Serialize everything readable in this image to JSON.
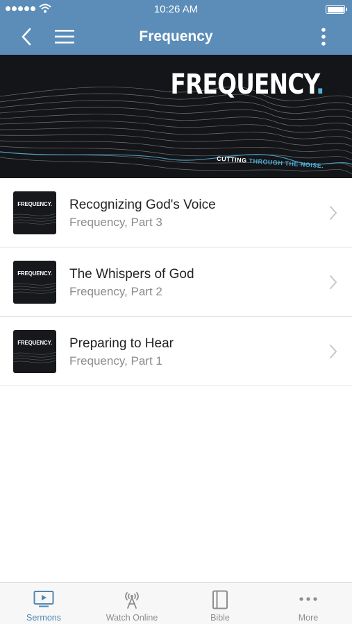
{
  "status_bar": {
    "time": "10:26 AM",
    "signal_icon": "signal-dots-icon",
    "wifi_icon": "wifi-icon",
    "battery_icon": "battery-icon"
  },
  "nav": {
    "title": "Frequency",
    "back_icon": "chevron-left-icon",
    "menu_icon": "hamburger-menu-icon",
    "more_icon": "vertical-dots-icon"
  },
  "banner": {
    "brand": "FREQUENCY",
    "brand_dot": ".",
    "tagline_a": "CUTTING",
    "tagline_b": "THROUGH THE NOISE."
  },
  "sermons": [
    {
      "title": "Recognizing God's Voice",
      "subtitle": "Frequency, Part 3",
      "thumb_label": "FREQUENCY."
    },
    {
      "title": "The Whispers of God",
      "subtitle": "Frequency, Part 2",
      "thumb_label": "FREQUENCY."
    },
    {
      "title": "Preparing to Hear",
      "subtitle": "Frequency, Part 1",
      "thumb_label": "FREQUENCY."
    }
  ],
  "tabs": [
    {
      "label": "Sermons",
      "icon": "tv-play-icon",
      "active": true
    },
    {
      "label": "Watch Online",
      "icon": "broadcast-tower-icon",
      "active": false
    },
    {
      "label": "Bible",
      "icon": "book-icon",
      "active": false
    },
    {
      "label": "More",
      "icon": "horizontal-dots-icon",
      "active": false
    }
  ],
  "colors": {
    "header": "#5b8db8",
    "accent": "#4f87b5",
    "banner_bg": "#141518",
    "brand_blue": "#4fb0d8"
  }
}
